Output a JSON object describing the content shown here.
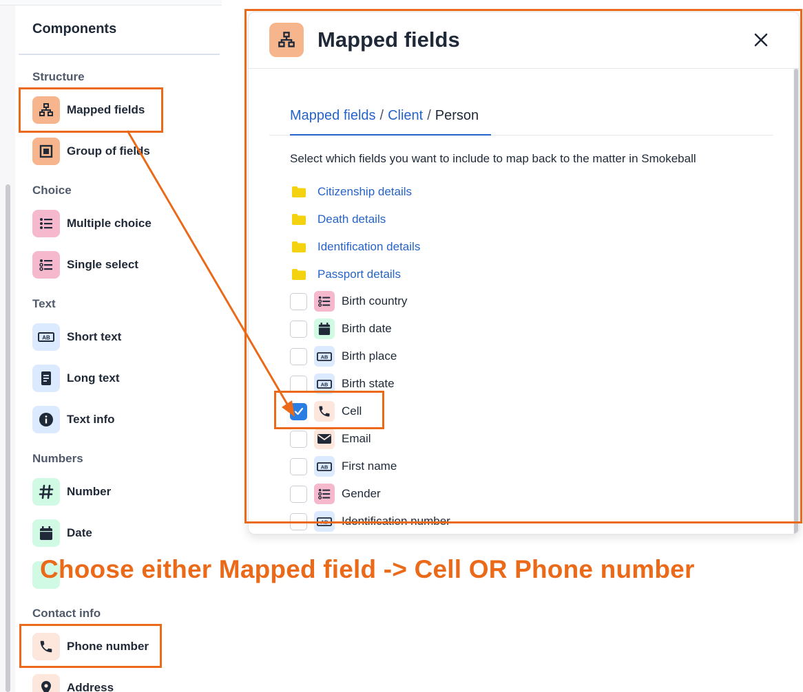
{
  "components_panel": {
    "title": "Components",
    "sections": {
      "structure": "Structure",
      "choice": "Choice",
      "text": "Text",
      "numbers": "Numbers",
      "contact": "Contact info"
    },
    "items": {
      "mapped_fields": "Mapped fields",
      "group_of_fields": "Group of fields",
      "multiple_choice": "Multiple choice",
      "single_select": "Single select",
      "short_text": "Short text",
      "long_text": "Long text",
      "text_info": "Text info",
      "number": "Number",
      "date": "Date",
      "phone_number": "Phone number",
      "address": "Address"
    }
  },
  "modal": {
    "title": "Mapped fields",
    "breadcrumb": [
      "Mapped fields",
      "Client",
      "Person"
    ],
    "breadcrumb_sep": "/",
    "instruction": "Select which fields you want to include to map back to the matter in Smokeball",
    "folders": [
      "Citizenship details",
      "Death details",
      "Identification details",
      "Passport details"
    ],
    "fields": [
      {
        "label": "Birth country",
        "icon": "list-icon",
        "checked": false
      },
      {
        "label": "Birth date",
        "icon": "calendar-icon",
        "checked": false
      },
      {
        "label": "Birth place",
        "icon": "text-field-icon",
        "checked": false
      },
      {
        "label": "Birth state",
        "icon": "text-field-icon",
        "checked": false
      },
      {
        "label": "Cell",
        "icon": "phone-icon",
        "checked": true
      },
      {
        "label": "Email",
        "icon": "mail-icon",
        "checked": false
      },
      {
        "label": "First name",
        "icon": "text-field-icon",
        "checked": false
      },
      {
        "label": "Gender",
        "icon": "list-icon",
        "checked": false
      },
      {
        "label": "Identification number",
        "icon": "text-field-icon",
        "checked": false
      }
    ]
  },
  "annotation": {
    "caption": "Choose either Mapped field -> Cell OR Phone number",
    "color": "#ea6a1a"
  },
  "colors": {
    "link": "#2563c9",
    "checkbox_checked": "#2a7de1",
    "folder": "#f5d20f"
  }
}
